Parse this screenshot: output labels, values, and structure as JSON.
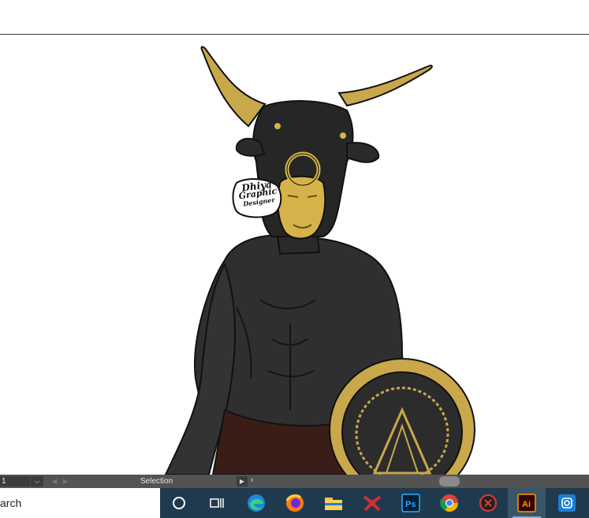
{
  "statusbar": {
    "zoom_value": "1",
    "dropdown_icon": "chevron-down-icon",
    "status_label": "Selection"
  },
  "artwork": {
    "logo_text_line1": "Dhiya",
    "logo_text_line2": "Graphic",
    "logo_text_line3": "Designer"
  },
  "taskbar": {
    "search_text": "arch",
    "apps": [
      {
        "name": "cortana",
        "label": "O"
      },
      {
        "name": "task-view",
        "label": "Task View"
      },
      {
        "name": "edge",
        "label": "Microsoft Edge"
      },
      {
        "name": "firefox",
        "label": "Firefox"
      },
      {
        "name": "file-explorer",
        "label": "File Explorer"
      },
      {
        "name": "app-red",
        "label": "App"
      },
      {
        "name": "photoshop",
        "label": "Ps"
      },
      {
        "name": "chrome",
        "label": "Chrome"
      },
      {
        "name": "app-dark",
        "label": "App"
      },
      {
        "name": "illustrator",
        "label": "Ai"
      },
      {
        "name": "instagram",
        "label": "Instagram"
      }
    ]
  }
}
